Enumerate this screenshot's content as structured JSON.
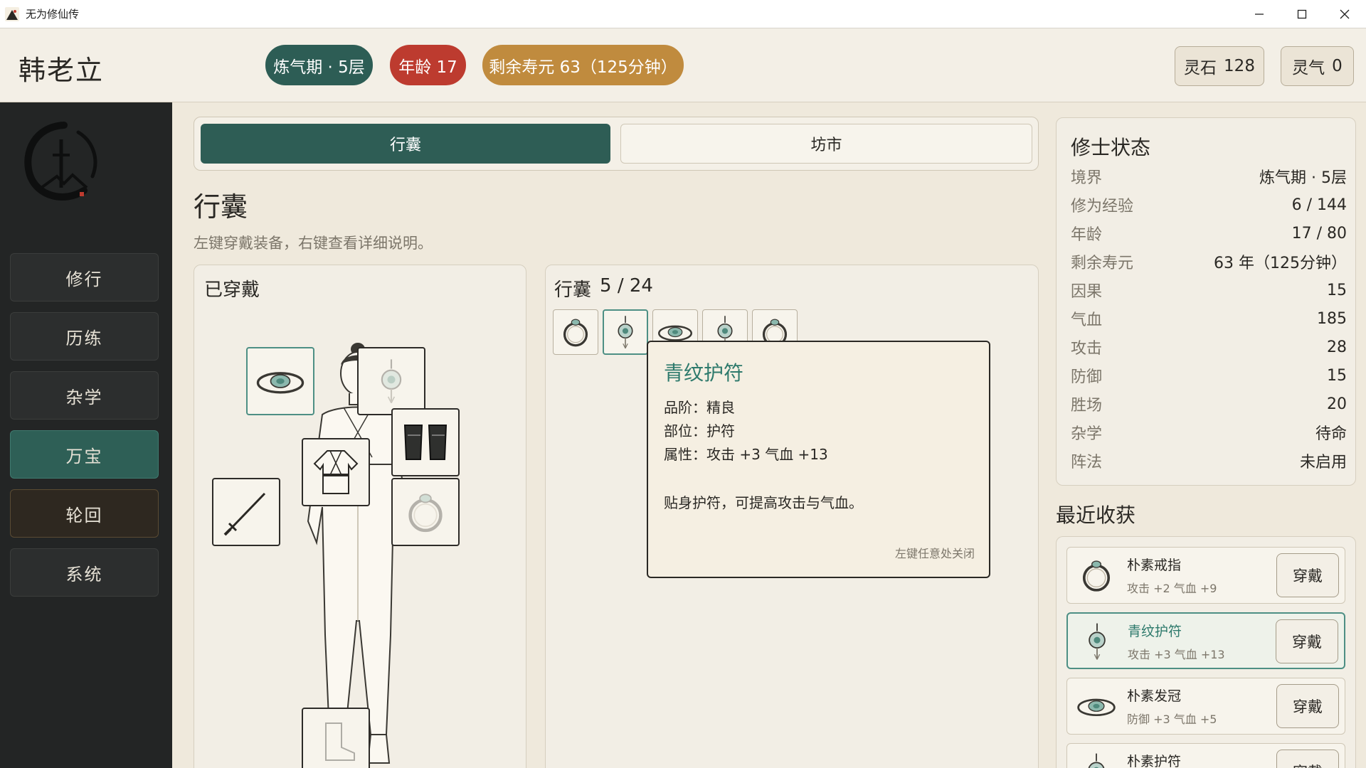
{
  "window": {
    "title": "无为修仙传"
  },
  "header": {
    "player_name": "韩老立",
    "realm_badge": "炼气期 · 5层",
    "age_badge": "年龄 17",
    "lifespan_badge": "剩余寿元 63（125分钟）",
    "spirit_stone_label": "灵石",
    "spirit_stone_value": "128",
    "spirit_qi_label": "灵气",
    "spirit_qi_value": "0"
  },
  "sidebar": {
    "items": [
      {
        "label": "修行"
      },
      {
        "label": "历练"
      },
      {
        "label": "杂学"
      },
      {
        "label": "万宝"
      },
      {
        "label": "轮回"
      },
      {
        "label": "系统"
      }
    ],
    "active": "万宝"
  },
  "tabs": {
    "bag": "行囊",
    "market": "坊市"
  },
  "page": {
    "title": "行囊",
    "hint": "左键穿戴装备，右键查看详细说明。"
  },
  "equipped": {
    "title": "已穿戴"
  },
  "bag": {
    "title": "行囊",
    "count": "5 / 24"
  },
  "tooltip": {
    "name": "青纹护符",
    "grade": "品阶：精良",
    "slot": "部位：护符",
    "attrs": "属性：攻击 +3    气血 +13",
    "desc": "贴身护符，可提高攻击与气血。",
    "close_hint": "左键任意处关闭"
  },
  "status": {
    "title": "修士状态",
    "rows": [
      {
        "k": "境界",
        "v": "炼气期 · 5层"
      },
      {
        "k": "修为经验",
        "v": "6 / 144"
      },
      {
        "k": "年龄",
        "v": "17 / 80"
      },
      {
        "k": "剩余寿元",
        "v": "63 年（125分钟）"
      },
      {
        "k": "因果",
        "v": "15"
      },
      {
        "k": "气血",
        "v": "185"
      },
      {
        "k": "攻击",
        "v": "28"
      },
      {
        "k": "防御",
        "v": "15"
      },
      {
        "k": "胜场",
        "v": "20"
      },
      {
        "k": "杂学",
        "v": "待命"
      },
      {
        "k": "阵法",
        "v": "未启用"
      }
    ]
  },
  "recent": {
    "title": "最近收获",
    "items": [
      {
        "name": "朴素戒指",
        "stats": "攻击 +2    气血 +9",
        "btn": "穿戴",
        "icon": "ring-icon"
      },
      {
        "name": "青纹护符",
        "stats": "攻击 +3    气血 +13",
        "btn": "穿戴",
        "icon": "amulet-icon"
      },
      {
        "name": "朴素发冠",
        "stats": "防御 +3    气血 +5",
        "btn": "穿戴",
        "icon": "crown-icon"
      },
      {
        "name": "朴素护符",
        "stats": "",
        "btn": "穿戴",
        "icon": "amulet-icon"
      }
    ]
  },
  "colors": {
    "accent_teal": "#2e5d55",
    "age_red": "#bd3b2f",
    "lifespan_gold": "#c08b3e",
    "item_name_teal": "#2e7a6c"
  }
}
